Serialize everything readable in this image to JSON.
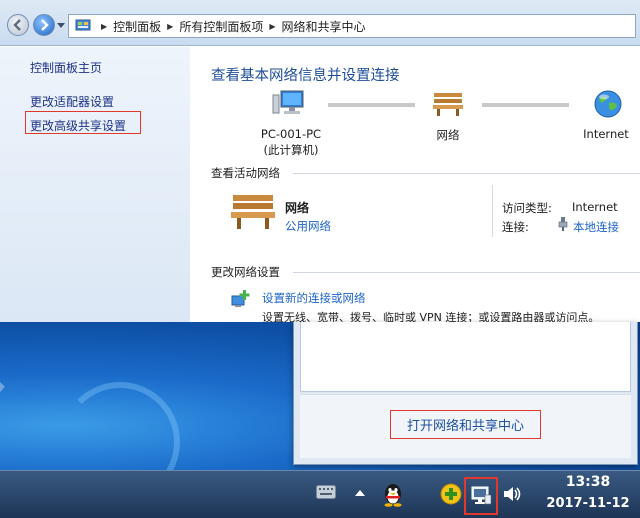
{
  "address_bar": {
    "crumbs": [
      "控制面板",
      "所有控制面板项",
      "网络和共享中心"
    ]
  },
  "sidebar": {
    "items": [
      {
        "label": "控制面板主页"
      },
      {
        "label": "更改适配器设置"
      },
      {
        "label": "更改高级共享设置"
      }
    ]
  },
  "main": {
    "title": "查看基本网络信息并设置连接",
    "map": {
      "computer_name": "PC-001-PC",
      "computer_sub": "(此计算机)",
      "network_name": "网络",
      "internet_name": "Internet"
    },
    "active_networks": {
      "title": "查看活动网络",
      "network_name": "网络",
      "network_type": "公用网络",
      "access_type_key": "访问类型:",
      "access_type_value": "Internet",
      "connection_key": "连接:",
      "connection_value": "本地连接"
    },
    "change_settings": {
      "title": "更改网络设置",
      "setup_link": "设置新的连接或网络",
      "setup_desc": "设置无线、宽带、拨号、临时或 VPN 连接；或设置路由器或访问点。"
    }
  },
  "popup": {
    "open_center_label": "打开网络和共享中心"
  },
  "taskbar": {
    "time": "13:38",
    "date": "2017-11-12"
  },
  "colors": {
    "highlight": "#e0382a",
    "link": "#1e64c8",
    "title": "#1f4e99"
  }
}
